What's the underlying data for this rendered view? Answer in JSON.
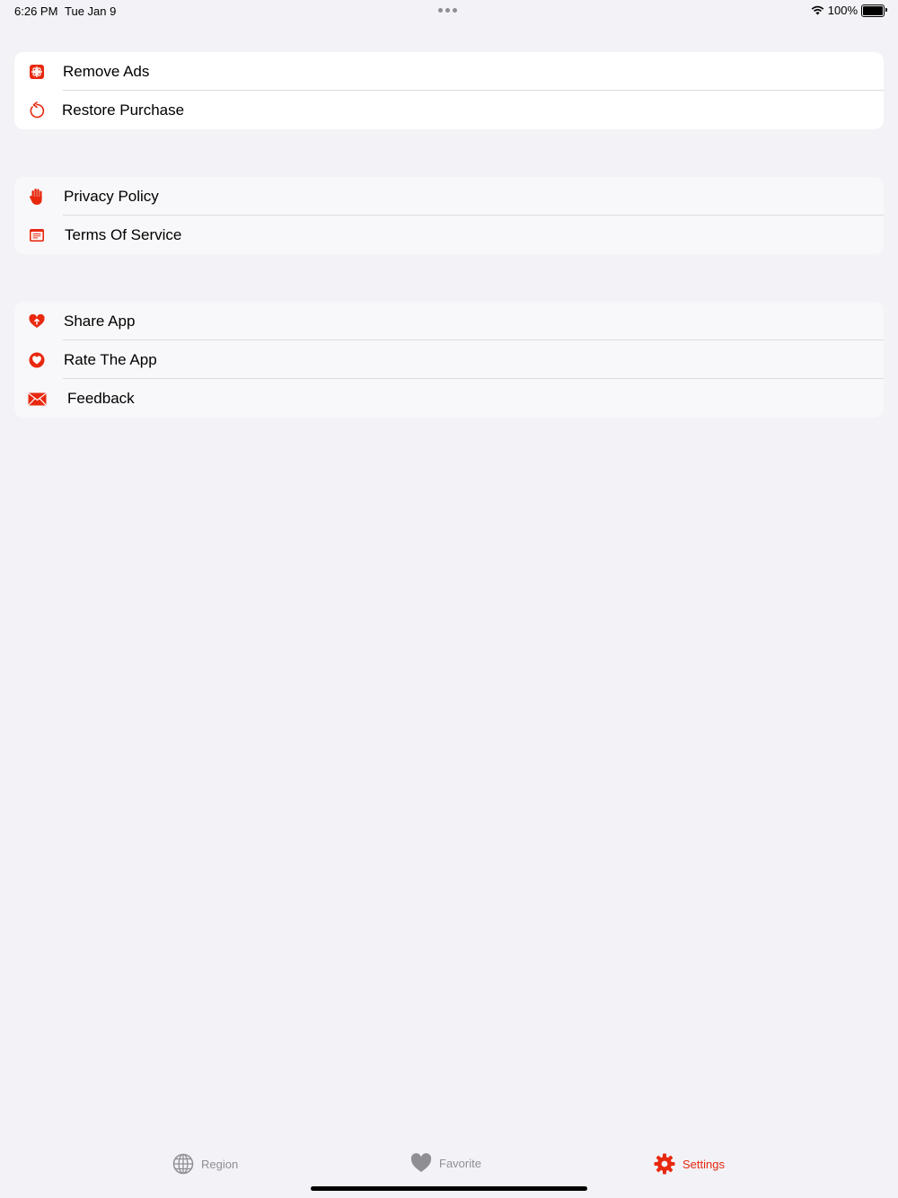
{
  "status_bar": {
    "time": "6:26 PM",
    "date": "Tue Jan 9",
    "battery_level": "100%"
  },
  "colors": {
    "accent": "#e8290f",
    "inactive": "#8e8e93",
    "background": "#f2f2f7"
  },
  "groups": [
    {
      "items": [
        {
          "label": "Remove Ads",
          "icon": "gift-icon"
        },
        {
          "label": "Restore Purchase",
          "icon": "restore-icon"
        }
      ]
    },
    {
      "items": [
        {
          "label": "Privacy Policy",
          "icon": "hand-icon"
        },
        {
          "label": "Terms Of Service",
          "icon": "document-icon"
        }
      ]
    },
    {
      "items": [
        {
          "label": "Share App",
          "icon": "heart-share-icon"
        },
        {
          "label": "Rate The App",
          "icon": "heart-circle-icon"
        },
        {
          "label": "Feedback",
          "icon": "envelope-icon"
        }
      ]
    }
  ],
  "tabs": [
    {
      "label": "Region",
      "icon": "globe-icon",
      "selected": false
    },
    {
      "label": "Favorite",
      "icon": "heart-icon",
      "selected": false
    },
    {
      "label": "Settings",
      "icon": "gear-icon",
      "selected": true
    }
  ]
}
